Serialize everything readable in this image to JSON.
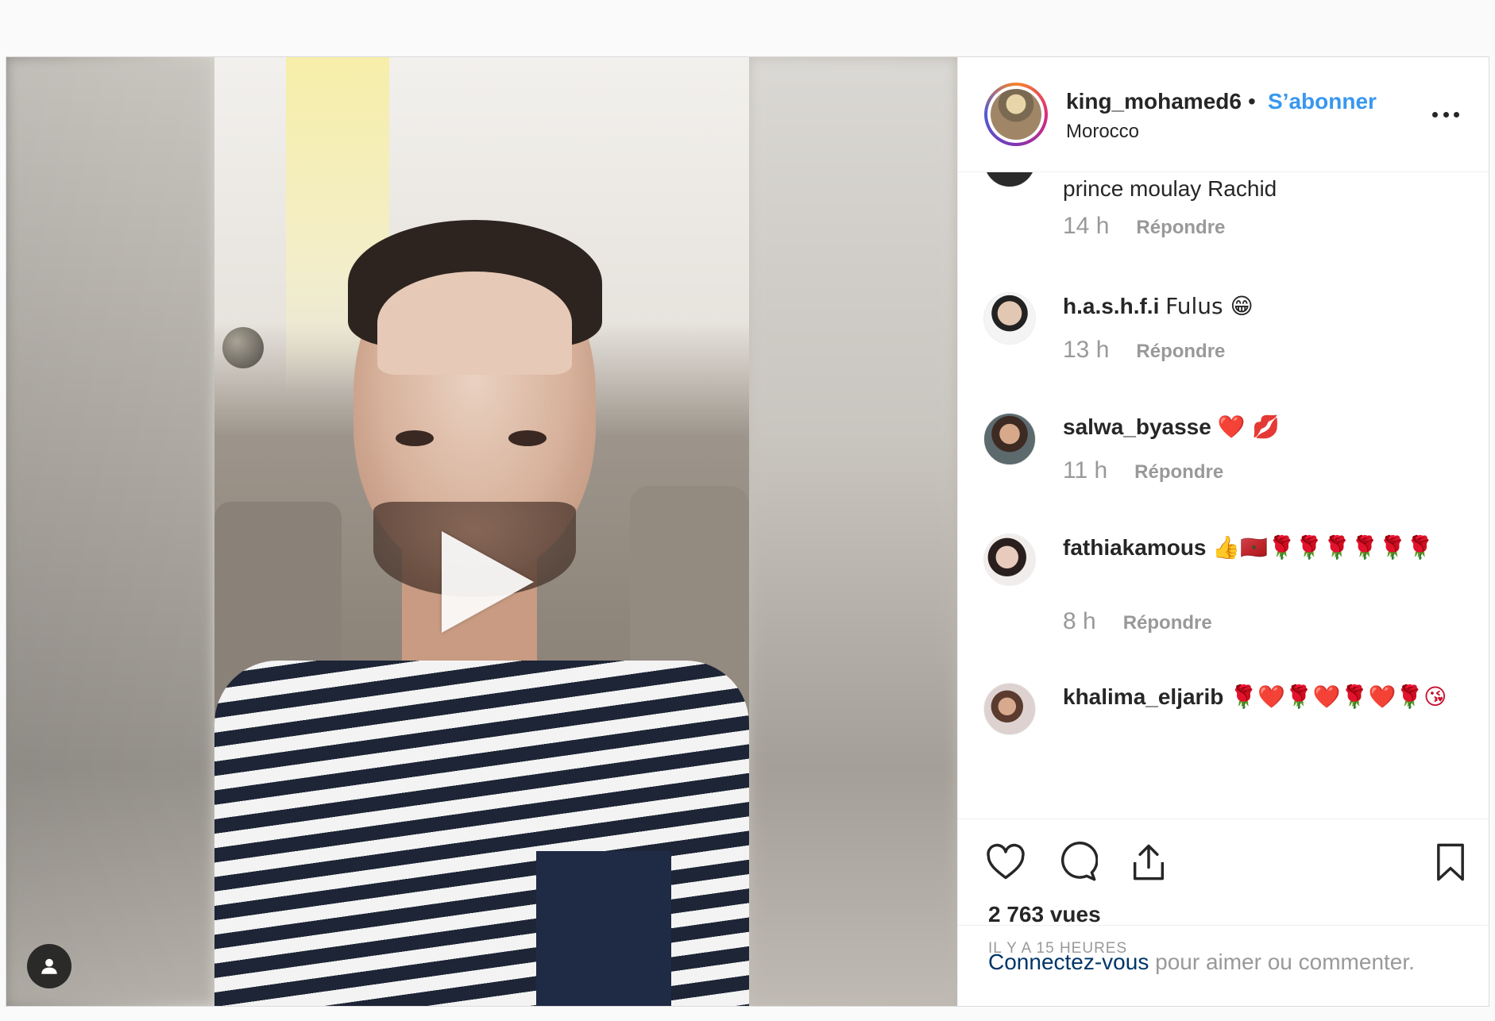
{
  "header": {
    "username": "king_mohamed6",
    "separator": "•",
    "follow_label": "S’abonner",
    "location": "Morocco"
  },
  "comments": [
    {
      "user": "",
      "text": "prince moulay Rachid",
      "time": "14 h",
      "reply": "Répondre"
    },
    {
      "user": "h.a.s.h.f.i",
      "text": "Fulus 😁",
      "time": "13 h",
      "reply": "Répondre"
    },
    {
      "user": "salwa_byasse",
      "text": "❤️ 💋",
      "time": "11 h",
      "reply": "Répondre"
    },
    {
      "user": "fathiakamous",
      "text": "👍🇲🇦🌹🌹🌹🌹🌹🌹",
      "time": "8 h",
      "reply": "Répondre"
    },
    {
      "user": "khalima_eljarib",
      "text": "🌹❤️🌹❤️🌹❤️🌹😘",
      "time": "",
      "reply": ""
    }
  ],
  "stats": {
    "views": "2 763 vues",
    "posted": "IL Y A 15 HEURES"
  },
  "login": {
    "link": "Connectez-vous",
    "rest": " pour aimer ou commenter."
  },
  "icons": {
    "play": "play-icon",
    "user_tag": "user-icon",
    "like": "heart-icon",
    "comment": "comment-icon",
    "share": "share-icon",
    "save": "bookmark-icon",
    "more": "more-icon"
  },
  "colors": {
    "follow": "#3897f0",
    "login_link": "#003569",
    "muted": "#999999",
    "text": "#262626"
  }
}
